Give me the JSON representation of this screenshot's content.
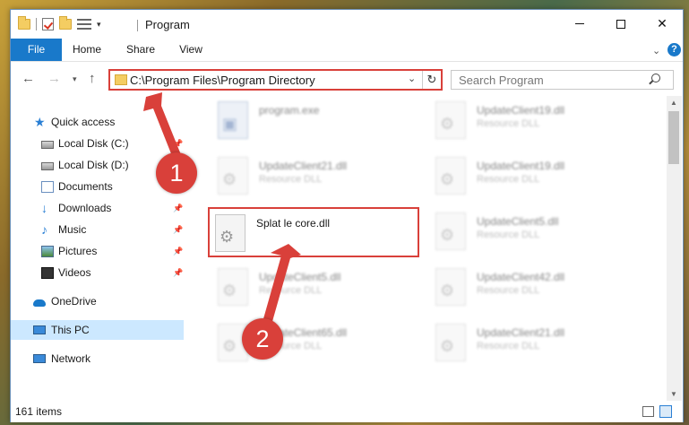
{
  "window": {
    "title": "Program",
    "minimize": "–",
    "close": "✕"
  },
  "ribbon": {
    "tabs": [
      "File",
      "Home",
      "Share",
      "View"
    ]
  },
  "toolbar": {
    "back": "←",
    "forward": "→",
    "up": "↑",
    "address_path": "C:\\Program Files\\Program Directory",
    "search_placeholder": "Search Program"
  },
  "sidebar": {
    "items": [
      {
        "label": "Quick access",
        "icon": "star-icon",
        "pinned": false
      },
      {
        "label": "Local Disk (C:)",
        "icon": "disk-icon",
        "pinned": true
      },
      {
        "label": "Local Disk (D:)",
        "icon": "disk-icon",
        "pinned": true
      },
      {
        "label": "Documents",
        "icon": "documents-icon",
        "pinned": true
      },
      {
        "label": "Downloads",
        "icon": "downloads-icon",
        "pinned": true
      },
      {
        "label": "Music",
        "icon": "music-icon",
        "pinned": true
      },
      {
        "label": "Pictures",
        "icon": "pictures-icon",
        "pinned": true
      },
      {
        "label": "Videos",
        "icon": "videos-icon",
        "pinned": true
      },
      {
        "label": "OneDrive",
        "icon": "onedrive-icon",
        "pinned": false
      },
      {
        "label": "This PC",
        "icon": "this-pc-icon",
        "pinned": false,
        "selected": true
      },
      {
        "label": "Network",
        "icon": "network-icon",
        "pinned": false
      }
    ]
  },
  "files": [
    {
      "name": "program.exe",
      "type": "",
      "kind": "exe",
      "blurred": true
    },
    {
      "name": "UpdateClient19.dll",
      "type": "Resource DLL",
      "kind": "dll",
      "blurred": true
    },
    {
      "name": "UpdateClient21.dll",
      "type": "Resource DLL",
      "kind": "dll",
      "blurred": true
    },
    {
      "name": "UpdateClient19.dll",
      "type": "Resource DLL",
      "kind": "dll",
      "blurred": true
    },
    {
      "name": "Splat le core.dll",
      "type": "",
      "kind": "dll",
      "blurred": false,
      "highlighted": true
    },
    {
      "name": "UpdateClient5.dll",
      "type": "Resource DLL",
      "kind": "dll",
      "blurred": true
    },
    {
      "name": "UpdateClient5.dll",
      "type": "Resource DLL",
      "kind": "dll",
      "blurred": true
    },
    {
      "name": "UpdateClient42.dll",
      "type": "Resource DLL",
      "kind": "dll",
      "blurred": true
    },
    {
      "name": "UpdateClient65.dll",
      "type": "Resource DLL",
      "kind": "dll",
      "blurred": true
    },
    {
      "name": "UpdateClient21.dll",
      "type": "Resource DLL",
      "kind": "dll",
      "blurred": true
    }
  ],
  "status": {
    "item_count": "161 items"
  },
  "callouts": [
    "1",
    "2"
  ],
  "colors": {
    "accent": "#1979ca",
    "annotation": "#d9403a",
    "selection": "#cce8ff"
  }
}
